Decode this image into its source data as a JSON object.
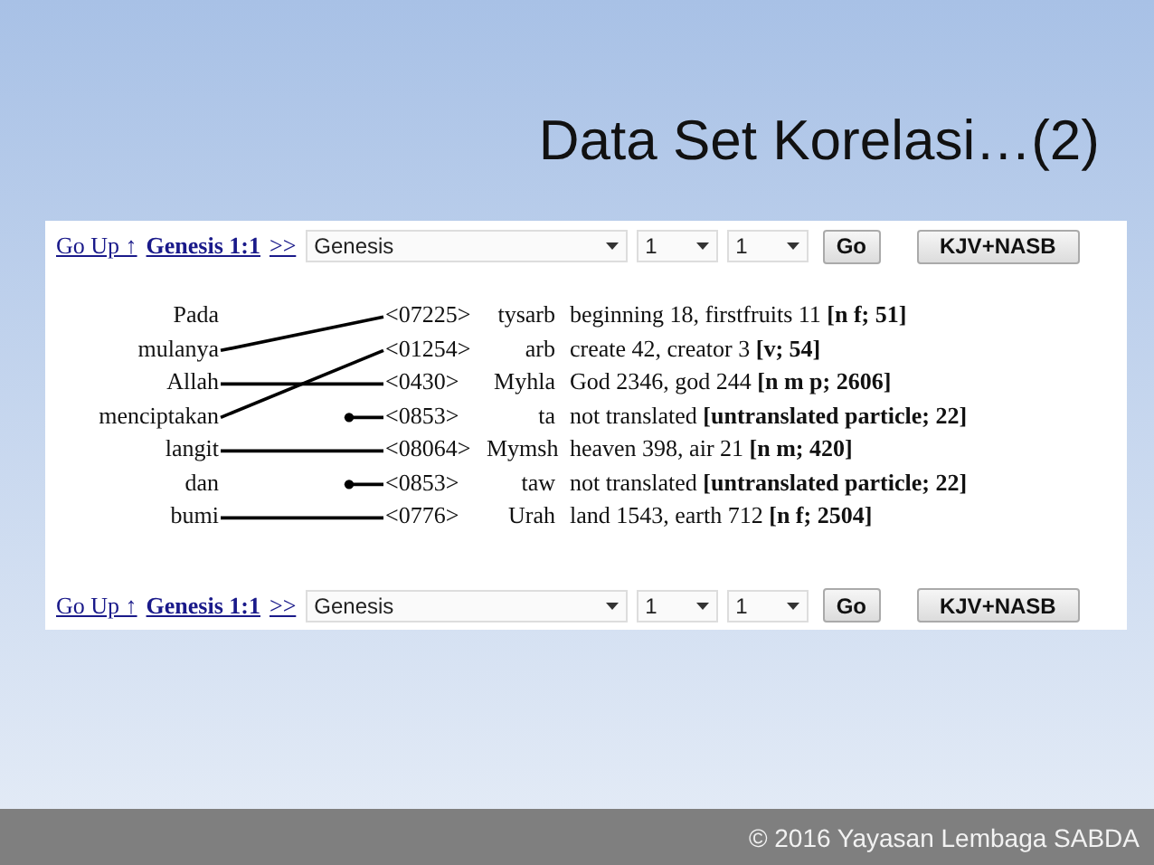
{
  "slide": {
    "title": "Data Set Korelasi…(2)",
    "footer": "© 2016 Yayasan Lembaga SABDA"
  },
  "screenshot": {
    "nav_top": {
      "up": "Go Up ↑",
      "verse": "Genesis 1:1",
      "next": ">>",
      "book": "Genesis",
      "chapter": "1",
      "verse_no": "1",
      "go": "Go",
      "version": "KJV+NASB"
    },
    "words": [
      {
        "text": "Pada",
        "kind": "unlinked"
      },
      {
        "text": "mulanya",
        "kind": "rising1"
      },
      {
        "text": "Allah",
        "kind": "level"
      },
      {
        "text": "menciptakan",
        "kind": "rising2"
      },
      {
        "text": "langit",
        "kind": "level"
      },
      {
        "text": "dan",
        "kind": "unlinked"
      },
      {
        "text": "bumi",
        "kind": "level"
      }
    ],
    "entries": [
      {
        "number": "<07225>",
        "hebrew": "tysarb",
        "gloss": "beginning 18, firstfruits 11 **[n f; 51]**",
        "dangling": false
      },
      {
        "number": "<01254>",
        "hebrew": "arb",
        "gloss": "create 42, creator 3 **[v; 54]**",
        "dangling": false
      },
      {
        "number": "<0430>",
        "hebrew": "Myhla",
        "gloss": "God 2346, god 244 **[n m p; 2606]**",
        "dangling": false
      },
      {
        "number": "<0853>",
        "hebrew": "ta",
        "gloss": "not translated **[untranslated particle; 22]**",
        "dangling": true
      },
      {
        "number": "<08064>",
        "hebrew": "Mymsh",
        "gloss": "heaven 398, air 21 **[n m; 420]**",
        "dangling": false
      },
      {
        "number": "<0853>",
        "hebrew": "taw",
        "gloss": "not translated **[untranslated particle; 22]**",
        "dangling": true
      },
      {
        "number": "<0776>",
        "hebrew": "Urah",
        "gloss": "land 1543, earth 712 **[n f; 2504]**",
        "dangling": false
      }
    ],
    "nav_bottom": {
      "up": "Go Up ↑",
      "verse": "Genesis 1:1",
      "next": ">>",
      "book": "Genesis",
      "chapter": "1",
      "verse_no": "1",
      "go": "Go",
      "version": "KJV+NASB"
    }
  }
}
